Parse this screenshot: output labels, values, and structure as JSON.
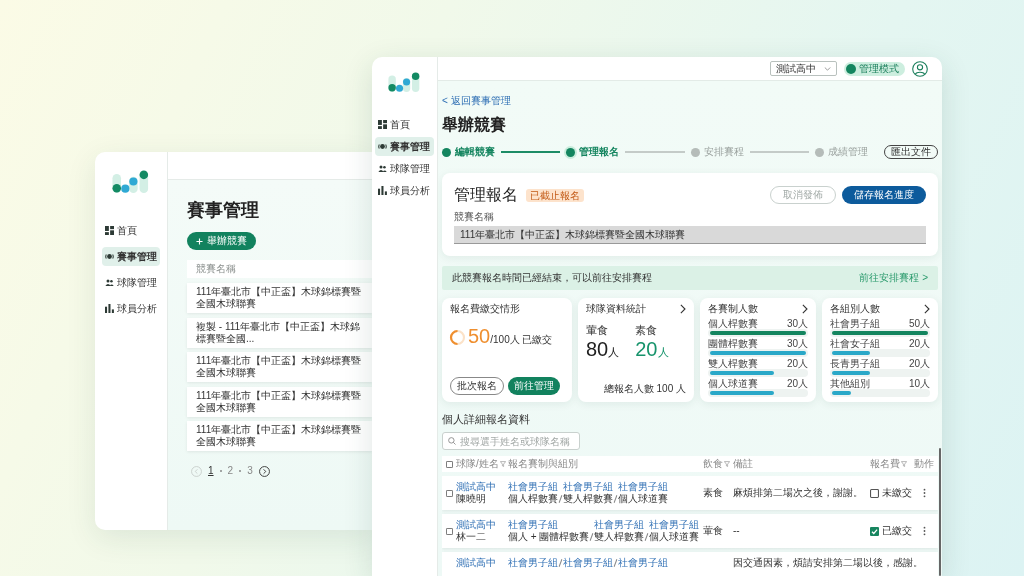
{
  "back_window": {
    "sidebar": {
      "items": [
        {
          "label": "首頁",
          "selected": false
        },
        {
          "label": "賽事管理",
          "selected": true
        },
        {
          "label": "球隊管理",
          "selected": false
        },
        {
          "label": "球員分析",
          "selected": false
        }
      ]
    },
    "title": "賽事管理",
    "add_button": "舉辦競賽",
    "table": {
      "columns": [
        "競賽名稱"
      ],
      "rows": [
        "111年臺北市【中正盃】木球錦標賽暨全國木球聯賽",
        "複製 - 111年臺北市【中正盃】木球錦標賽暨全國...",
        "111年臺北市【中正盃】木球錦標賽暨全國木球聯賽",
        "111年臺北市【中正盃】木球錦標賽暨全國木球聯賽",
        "111年臺北市【中正盃】木球錦標賽暨全國木球聯賽"
      ]
    },
    "pagination": {
      "prev_disabled": true,
      "next_disabled": false,
      "pages": [
        {
          "label": "1",
          "selected": true
        },
        {
          "label": "2",
          "selected": false
        },
        {
          "label": "3",
          "selected": false
        }
      ]
    }
  },
  "front_window": {
    "top_bar": {
      "school_dropdown": "測試高中",
      "mode_toggle": {
        "label": "管理模式",
        "on": true
      }
    },
    "sidebar": {
      "items": [
        {
          "label": "首頁",
          "selected": false
        },
        {
          "label": "賽事管理",
          "selected": true
        },
        {
          "label": "球隊管理",
          "selected": false
        },
        {
          "label": "球員分析",
          "selected": false
        }
      ]
    },
    "back_link": "< 返回賽事管理",
    "title": "舉辦競賽",
    "stepper": {
      "steps": [
        {
          "label": "編輯競賽",
          "completed": true,
          "selected": false
        },
        {
          "label": "管理報名",
          "completed": false,
          "selected": true
        },
        {
          "label": "安排賽程",
          "completed": false,
          "selected": false
        },
        {
          "label": "成績管理",
          "completed": false,
          "selected": false
        }
      ],
      "action": "匯出文件"
    },
    "registration_card": {
      "title": "管理報名",
      "badge": "已截止報名",
      "buttons": [
        {
          "label": "取消發佈",
          "kind": "outline",
          "disabled": true
        },
        {
          "label": "儲存報名進度",
          "kind": "primary",
          "disabled": false
        }
      ],
      "field": {
        "label": "競賽名稱",
        "value": "111年臺北市【中正盃】木球錦標賽暨全國木球聯賽",
        "disabled": true
      }
    },
    "notice": {
      "text": "此競賽報名時間已經結束，可以前往安排賽程",
      "link": "前往安排賽程 >"
    },
    "stat_cards": [
      {
        "kind": "fee",
        "title": "報名費繳交情形",
        "level": 0.5,
        "value": "50",
        "suffix": "/100人 已繳交",
        "buttons": [
          {
            "label": "批次報名",
            "kind": "outline"
          },
          {
            "label": "前往管理",
            "kind": "primary"
          }
        ]
      },
      {
        "kind": "split",
        "title": "球隊資料統計",
        "stats": [
          {
            "label": "葷食",
            "value": "80",
            "unit": "人",
            "color": "#222222"
          },
          {
            "label": "素食",
            "value": "20",
            "unit": "人",
            "color": "#16936b"
          }
        ],
        "footer": "總報名人數 100 人"
      },
      {
        "kind": "bars",
        "title": "各賽制人數",
        "bars": [
          {
            "label": "個人桿數賽",
            "value": "30人",
            "level": 1,
            "color": "#14855f"
          },
          {
            "label": "團體桿數賽",
            "value": "30人",
            "level": 1,
            "color": "#2aa8c8"
          },
          {
            "label": "雙人桿數賽",
            "value": "20人",
            "level": 0.67,
            "color": "#2aa8c8"
          },
          {
            "label": "個人球道賽",
            "value": "20人",
            "level": 0.67,
            "color": "#2aa8c8"
          }
        ]
      },
      {
        "kind": "bars",
        "title": "各組別人數",
        "bars": [
          {
            "label": "社會男子組",
            "value": "50人",
            "level": 1,
            "color": "#14855f"
          },
          {
            "label": "社會女子組",
            "value": "20人",
            "level": 0.4,
            "color": "#2aa8c8"
          },
          {
            "label": "長青男子組",
            "value": "20人",
            "level": 0.4,
            "color": "#2aa8c8"
          },
          {
            "label": "其他組別",
            "value": "10人",
            "level": 0.2,
            "color": "#2aa8c8"
          }
        ]
      }
    ],
    "detail_table": {
      "title": "個人詳細報名資料",
      "search": {
        "placeholder": "搜尋選手姓名或球隊名稱"
      },
      "select_all": false,
      "columns": [
        {
          "label": "球隊/姓名",
          "filter": true
        },
        {
          "label": "報名賽制與組別",
          "filter": false
        },
        {
          "label": "飲食",
          "filter": true
        },
        {
          "label": "備註",
          "filter": false
        },
        {
          "label": "報名費",
          "filter": true
        },
        {
          "label": "動作",
          "filter": false
        }
      ],
      "rows": [
        {
          "selected": false,
          "team": "測試高中",
          "name": "陳曉明",
          "entries": [
            {
              "group": "社會男子組",
              "event": "個人桿數賽"
            },
            {
              "group": "社會男子組",
              "event": "雙人桿數賽"
            },
            {
              "group": "社會男子組",
              "event": "個人球道賽"
            }
          ],
          "diet": "素食",
          "remark": "麻煩排第二場次之後，謝謝。",
          "paid": false,
          "fee_label": "未繳交"
        },
        {
          "selected": false,
          "team": "測試高中",
          "name": "林一二",
          "entries": [
            {
              "group": "社會男子組",
              "event": "個人 + 團體桿數賽"
            },
            {
              "group": "社會男子組",
              "event": "雙人桿數賽"
            },
            {
              "group": "社會男子組",
              "event": "個人球道賽"
            }
          ],
          "diet": "葷食",
          "remark": "--",
          "paid": true,
          "fee_label": "已繳交"
        },
        {
          "team": "測試高中",
          "entries": [
            {
              "group": "社會男子組"
            },
            {
              "group": "社會男子組"
            },
            {
              "group": "社會男子組"
            }
          ],
          "remark": "因交通因素，煩請安排第二場以後，感謝。"
        }
      ]
    }
  }
}
